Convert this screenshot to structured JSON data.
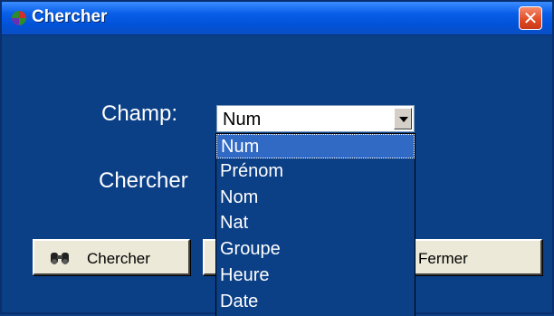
{
  "window": {
    "title": "Chercher",
    "close_symbol": "✕"
  },
  "form": {
    "field_label": "Champ:",
    "search_label": "Chercher",
    "selected_value": "Num"
  },
  "dropdown": {
    "options": [
      "Num",
      "Prénom",
      "Nom",
      "Nat",
      "Groupe",
      "Heure",
      "Date"
    ]
  },
  "buttons": {
    "search_label": "Chercher",
    "close_label": "Fermer"
  },
  "icons": {
    "app": "app-icon",
    "binoculars": "binoculars-icon",
    "close": "close-icon"
  }
}
